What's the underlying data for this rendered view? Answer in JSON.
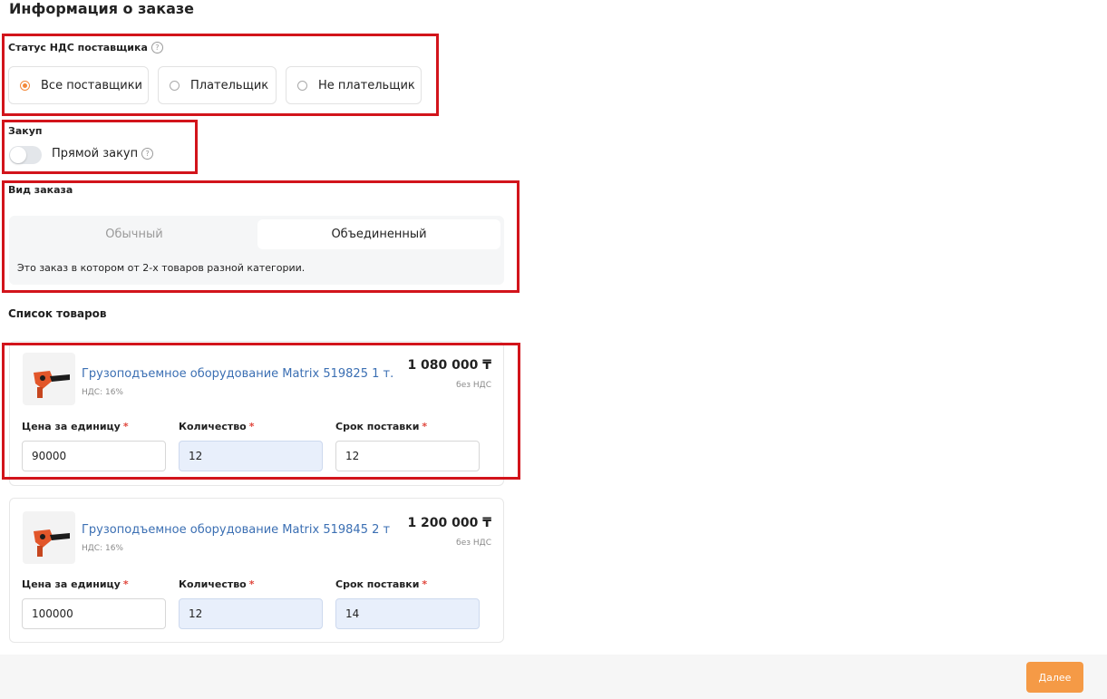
{
  "page": {
    "title": "Информация о заказе"
  },
  "vat_status": {
    "label": "Статус НДС поставщика",
    "options": [
      "Все поставщики",
      "Плательщик",
      "Не плательщик"
    ],
    "selected": "Все поставщики"
  },
  "purchase": {
    "label": "Закуп",
    "toggle_label": "Прямой закуп",
    "toggle_on": false
  },
  "order_type": {
    "label": "Вид заказа",
    "options": [
      "Обычный",
      "Объединенный"
    ],
    "selected": "Объединенный",
    "description": "Это заказ в котором от 2-х товаров разной категории."
  },
  "products": {
    "heading": "Список товаров",
    "field_labels": {
      "unit_price": "Цена за единицу",
      "quantity": "Количество",
      "delivery": "Срок поставки",
      "required_mark": "*"
    },
    "items": [
      {
        "name": "Грузоподъемное оборудование Matrix 519825 1 т.",
        "vat": "НДС: 16%",
        "price": "1 080 000 ₸",
        "price_note": "без НДС",
        "unit_price": "90000",
        "quantity": "12",
        "delivery": "12"
      },
      {
        "name": "Грузоподъемное оборудование Matrix 519845 2 т",
        "vat": "НДС: 16%",
        "price": "1 200 000 ₸",
        "price_note": "без НДС",
        "unit_price": "100000",
        "quantity": "12",
        "delivery": "14"
      }
    ]
  },
  "footer": {
    "next_label": "Далее"
  },
  "colors": {
    "accent": "#f59a46",
    "link": "#3b6fb3",
    "highlight_frame": "#d2141b"
  },
  "icons": [
    "help-icon",
    "radio-icon",
    "product-jack-image"
  ]
}
